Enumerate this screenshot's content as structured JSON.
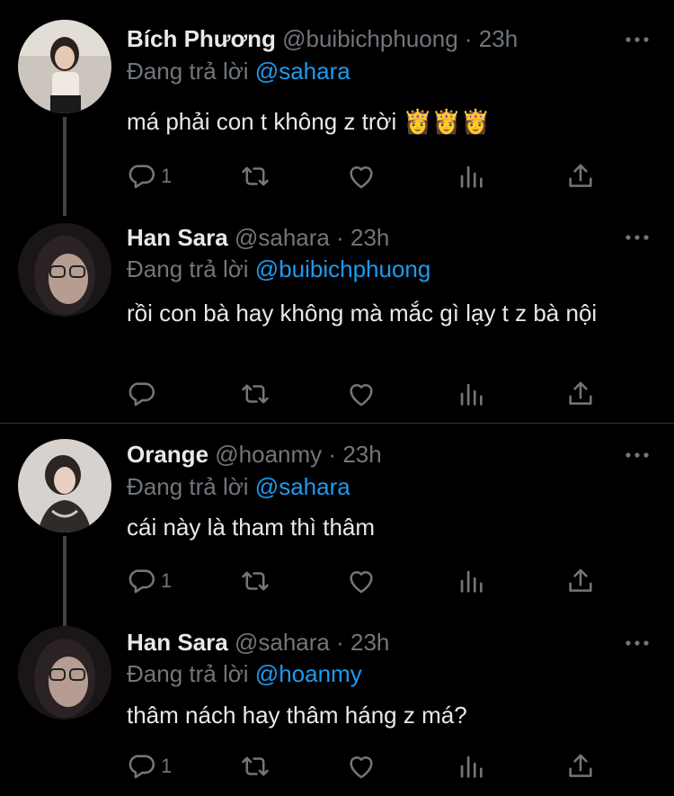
{
  "tweets": [
    {
      "name": "Bích Phương",
      "handle": "@buibichphuong",
      "dot": "·",
      "time": "23h",
      "reply_prefix": "Đang trả lời",
      "reply_to": "@sahara",
      "text": "má phải con t không z trời 👸👸👸",
      "reply_count": "1",
      "avatar_color": "#c9c2b8"
    },
    {
      "name": "Han Sara",
      "handle": "@sahara",
      "dot": "·",
      "time": "23h",
      "reply_prefix": "Đang trả lời",
      "reply_to": "@buibichphuong",
      "text": "rồi con bà hay không mà mắc gì lạy t z bà nội",
      "reply_count": "",
      "avatar_color": "#3a3234"
    },
    {
      "name": "Orange",
      "handle": "@hoanmy",
      "dot": "·",
      "time": "23h",
      "reply_prefix": "Đang trả lời",
      "reply_to": "@sahara",
      "text": "cái này là tham thì thâm",
      "reply_count": "1",
      "avatar_color": "#d8d3cf"
    },
    {
      "name": "Han Sara",
      "handle": "@sahara",
      "dot": "·",
      "time": "23h",
      "reply_prefix": "Đang trả lời",
      "reply_to": "@hoanmy",
      "text": "thâm nách hay thâm háng z má?",
      "reply_count": "1",
      "avatar_color": "#3a3234"
    }
  ],
  "colors": {
    "background": "#000000",
    "text": "#e7e9ea",
    "muted": "#71767b",
    "mention": "#1d9bf0",
    "thread_line": "#3d4348"
  },
  "icons": [
    "reply-icon",
    "retweet-icon",
    "like-icon",
    "views-icon",
    "share-icon",
    "more-icon"
  ]
}
